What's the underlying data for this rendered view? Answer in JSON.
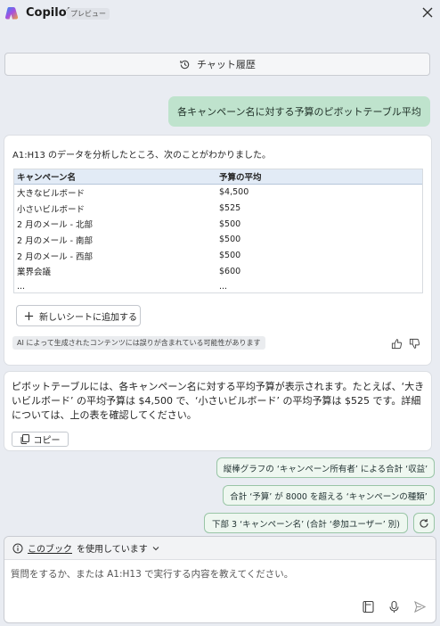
{
  "app": {
    "title": "Copilot",
    "badge": "プレビュー"
  },
  "history": {
    "label": "チャット履歴"
  },
  "user_message": "各キャンペーン名に対する予算のピボットテーブル平均",
  "response": {
    "intro": "A1:H13 のデータを分析したところ、次のことがわかりました。",
    "table": {
      "headers": [
        "キャンペーン名",
        "予算の平均"
      ],
      "rows": [
        [
          "大きなビルボード",
          "$4,500"
        ],
        [
          "小さいビルボード",
          "$525"
        ],
        [
          "2 月のメール - 北部",
          "$500"
        ],
        [
          "2 月のメール - 南部",
          "$500"
        ],
        [
          "2 月のメール - 西部",
          "$500"
        ],
        [
          "業界会議",
          "$600"
        ],
        [
          "...",
          "..."
        ]
      ]
    },
    "add_sheet_label": "新しいシートに追加する",
    "disclaimer": "AI によって生成されたコンテンツには誤りが含まれている可能性があります"
  },
  "summary": {
    "text": "ピボットテーブルには、各キャンペーン名に対する平均予算が表示されます。たとえば、‘大きいビルボード’ の平均予算は $4,500 で、‘小さいビルボード’ の平均予算は $525 です。詳細については、上の表を確認してください。",
    "copy_label": "コピー"
  },
  "suggestions": [
    "縦棒グラフの ‘キャンペーン所有者’ による合計 ‘収益’",
    "合計 ‘予算’ が 8000 を超える ‘キャンペーンの種類’",
    "下部 3 ‘キャンペーン名’ (合計 ‘参加ユーザー’ 別)"
  ],
  "composer": {
    "context_link": "このブック",
    "context_suffix": "を使用しています",
    "placeholder": "質問をするか、または A1:H13 で実行する内容を教えてください。"
  },
  "colors": {
    "accent_green": "#bfe3cd",
    "table_header": "#e2ebf6"
  },
  "icons": [
    "copilot-logo-icon",
    "close-icon",
    "history-icon",
    "plus-icon",
    "thumbs-up-icon",
    "thumbs-down-icon",
    "copy-icon",
    "refresh-icon",
    "info-icon",
    "chevron-down-icon",
    "notebook-icon",
    "microphone-icon",
    "send-icon"
  ]
}
